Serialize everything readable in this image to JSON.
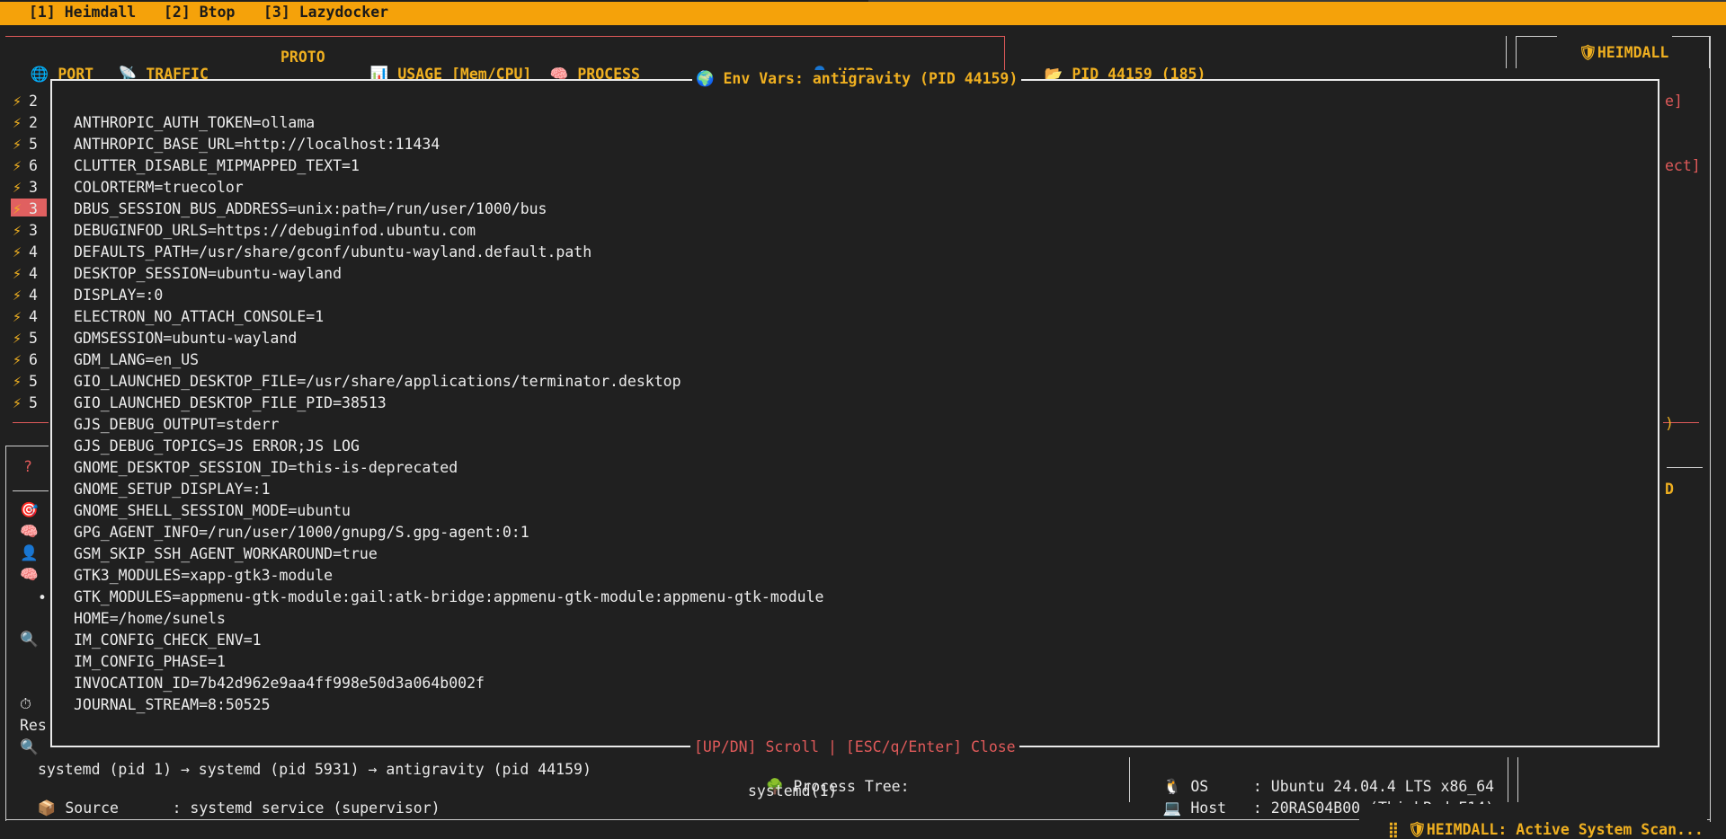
{
  "tabs": [
    {
      "label": "[1] Heimdall"
    },
    {
      "label": "[2] Btop"
    },
    {
      "label": "[3] Lazydocker"
    }
  ],
  "columns": {
    "port": "PORT",
    "traffic": "TRAFFIC",
    "proto": "PROTO",
    "usage": "USAGE [Mem/CPU]",
    "process": "PROCESS",
    "user": "USER"
  },
  "pid_panel": {
    "title": "PID 44159 (185)"
  },
  "heimdall_panel": {
    "title": "HEIMDALL"
  },
  "left_rows": [
    "2",
    "2",
    "5",
    "6",
    "3",
    "3",
    "3",
    "4",
    "4",
    "4",
    "4",
    "5",
    "6",
    "5",
    "5"
  ],
  "right_fragments": {
    "r1": "e]",
    "r2": "ect]",
    "r3": ")",
    "r4": "D"
  },
  "left_misc": {
    "question": "?",
    "dot": "•",
    "res": "Res"
  },
  "modal": {
    "title": "Env Vars: antigravity (PID 44159)",
    "footer": "[UP/DN] Scroll | [ESC/q/Enter] Close",
    "env_vars": [
      "ANTHROPIC_AUTH_TOKEN=ollama",
      "ANTHROPIC_BASE_URL=http://localhost:11434",
      "CLUTTER_DISABLE_MIPMAPPED_TEXT=1",
      "COLORTERM=truecolor",
      "DBUS_SESSION_BUS_ADDRESS=unix:path=/run/user/1000/bus",
      "DEBUGINFOD_URLS=https://debuginfod.ubuntu.com",
      "DEFAULTS_PATH=/usr/share/gconf/ubuntu-wayland.default.path",
      "DESKTOP_SESSION=ubuntu-wayland",
      "DISPLAY=:0",
      "ELECTRON_NO_ATTACH_CONSOLE=1",
      "GDMSESSION=ubuntu-wayland",
      "GDM_LANG=en_US",
      "GIO_LAUNCHED_DESKTOP_FILE=/usr/share/applications/terminator.desktop",
      "GIO_LAUNCHED_DESKTOP_FILE_PID=38513",
      "GJS_DEBUG_OUTPUT=stderr",
      "GJS_DEBUG_TOPICS=JS ERROR;JS LOG",
      "GNOME_DESKTOP_SESSION_ID=this-is-deprecated",
      "GNOME_SETUP_DISPLAY=:1",
      "GNOME_SHELL_SESSION_MODE=ubuntu",
      "GPG_AGENT_INFO=/run/user/1000/gnupg/S.gpg-agent:0:1",
      "GSM_SKIP_SSH_AGENT_WORKAROUND=true",
      "GTK3_MODULES=xapp-gtk3-module",
      "GTK_MODULES=appmenu-gtk-module:gail:atk-bridge:appmenu-gtk-module:appmenu-gtk-module",
      "HOME=/home/sunels",
      "IM_CONFIG_CHECK_ENV=1",
      "IM_CONFIG_PHASE=1",
      "INVOCATION_ID=7b42d962e9aa4ff998e50d3a064b002f",
      "JOURNAL_STREAM=8:50525"
    ]
  },
  "bottom": {
    "chain": "systemd (pid 1) → systemd (pid 5931) → antigravity (pid 44159)",
    "source": "Source      : systemd service (supervisor)",
    "tree_title": "Process Tree:",
    "tree_root": "systemd(1)",
    "os": "OS     : Ubuntu 24.04.4 LTS x86_64",
    "host": "Host   : 20RAS04B00 (ThinkPad E14)",
    "status": "HEIMDALL: Active System Scan..."
  },
  "colors": {
    "accent": "#f5a20a",
    "alert": "#e05a5a",
    "text": "#e8e8e8",
    "bg": "#202020"
  }
}
